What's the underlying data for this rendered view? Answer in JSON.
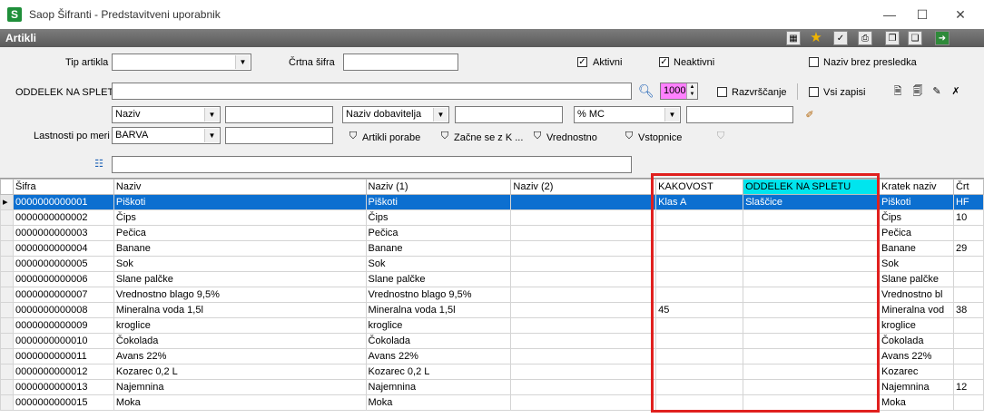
{
  "window": {
    "title": "Saop Šifranti - Predstavitveni uporabnik",
    "minimize": "—",
    "maximize": "☐",
    "close": "✕"
  },
  "section": {
    "title": "Artikli"
  },
  "filters": {
    "tip_artikla_label": "Tip artikla",
    "tip_artikla_value": "",
    "crtna_sifra_label": "Črtna šifra",
    "crtna_sifra_value": "",
    "aktivni_label": "Aktivni",
    "neaktivni_label": "Neaktivni",
    "naziv_brez_label": "Naziv brez presledka",
    "oddelek_label": "ODDELEK NA SPLETU",
    "oddelek_value": "",
    "count_value": "1000",
    "razvrscanje_label": "Razvrščanje",
    "vsi_zapisi_label": "Vsi zapisi",
    "combo1": "Naziv",
    "combo2": "Naziv dobavitelja",
    "combo3": "% MC",
    "lastnosti_label": "Lastnosti po meri",
    "combo4": "BARVA",
    "btn_porabe": "Artikli porabe",
    "btn_zacne": "Začne se z K ...",
    "btn_vrednostno": "Vrednostno",
    "btn_vstopnice": "Vstopnice"
  },
  "grid": {
    "headers": [
      "Šifra",
      "Naziv",
      "Naziv (1)",
      "Naziv (2)",
      "KAKOVOST",
      "ODDELEK NA SPLETU",
      "Kratek naziv",
      "Črt"
    ],
    "rows": [
      [
        "0000000000001",
        "Piškoti",
        "Piškoti",
        "",
        "Klas A",
        "Slaščice",
        "Piškoti",
        "HF"
      ],
      [
        "0000000000002",
        "Čips",
        "Čips",
        "",
        "",
        "",
        "Čips",
        "10"
      ],
      [
        "0000000000003",
        "Pečica",
        "Pečica",
        "",
        "",
        "",
        "Pečica",
        ""
      ],
      [
        "0000000000004",
        "Banane",
        "Banane",
        "",
        "",
        "",
        "Banane",
        "29"
      ],
      [
        "0000000000005",
        "Sok",
        "Sok",
        "",
        "",
        "",
        "Sok",
        ""
      ],
      [
        "0000000000006",
        "Slane palčke",
        "Slane palčke",
        "",
        "",
        "",
        "Slane palčke",
        ""
      ],
      [
        "0000000000007",
        "Vrednostno blago 9,5%",
        "Vrednostno blago 9,5%",
        "",
        "",
        "",
        "Vrednostno bl",
        ""
      ],
      [
        "0000000000008",
        "Mineralna voda 1,5l",
        "Mineralna voda 1,5l",
        "",
        "45",
        "",
        "Mineralna vod",
        "38"
      ],
      [
        "0000000000009",
        "kroglice",
        "kroglice",
        "",
        "",
        "",
        "kroglice",
        ""
      ],
      [
        "0000000000010",
        "Čokolada",
        "Čokolada",
        "",
        "",
        "",
        "Čokolada",
        ""
      ],
      [
        "0000000000011",
        "Avans 22%",
        "Avans 22%",
        "",
        "",
        "",
        "Avans 22%",
        ""
      ],
      [
        "0000000000012",
        "Kozarec 0,2  L",
        "Kozarec 0,2  L",
        "",
        "",
        "",
        "Kozarec",
        ""
      ],
      [
        "0000000000013",
        "Najemnina",
        "Najemnina",
        "",
        "",
        "",
        "Najemnina",
        "12"
      ],
      [
        "0000000000015",
        "Moka",
        "Moka",
        "",
        "",
        "",
        "Moka",
        ""
      ]
    ]
  },
  "colors": {
    "selection": "#0c6fd0",
    "header_highlight": "#00e5ee",
    "count_highlight": "#ff80ff",
    "annotation": "#e0201e"
  }
}
